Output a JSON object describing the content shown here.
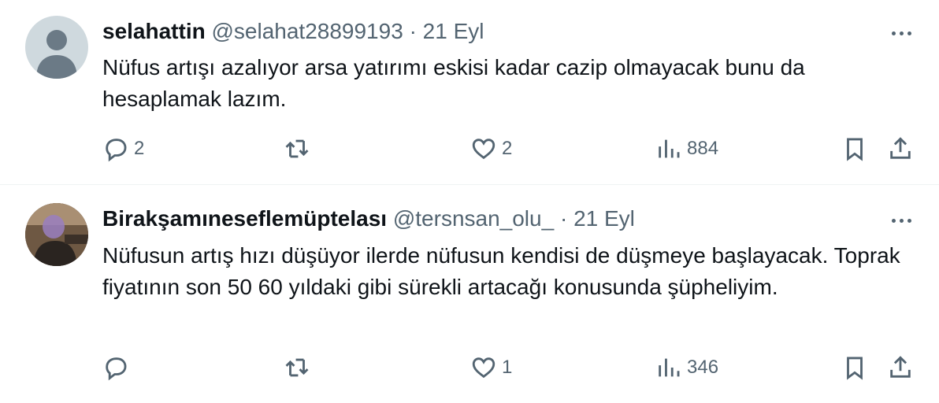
{
  "tweets": [
    {
      "name": "selahattin",
      "handle": "@selahat28899193",
      "separator": "·",
      "date": "21 Eyl",
      "text": "Nüfus artışı azalıyor arsa yatırımı eskisi kadar cazip olmayacak bunu da hesaplamak lazım.",
      "replies": "2",
      "retweets": "",
      "likes": "2",
      "views": "884",
      "avatar": "default-avatar"
    },
    {
      "name": "Birakşamıneseflemüptelası",
      "handle": "@tersnsan_olu_",
      "separator": "·",
      "date": "21 Eyl",
      "text": "Nüfusun artış hızı düşüyor ilerde nüfusun kendisi de düşmeye başlayacak. Toprak fiyatının son 50 60 yıldaki gibi sürekli artacağı konusunda şüpheliyim.",
      "replies": "",
      "retweets": "",
      "likes": "1",
      "views": "346",
      "avatar": "photo-avatar"
    }
  ],
  "colors": {
    "text": "#0f1419",
    "secondary": "#536471",
    "divider": "#eff3f4",
    "avatar_placeholder": "#cfd9de"
  },
  "icons": [
    "more-icon",
    "reply-icon",
    "retweet-icon",
    "like-icon",
    "views-icon",
    "bookmark-icon",
    "share-icon"
  ]
}
